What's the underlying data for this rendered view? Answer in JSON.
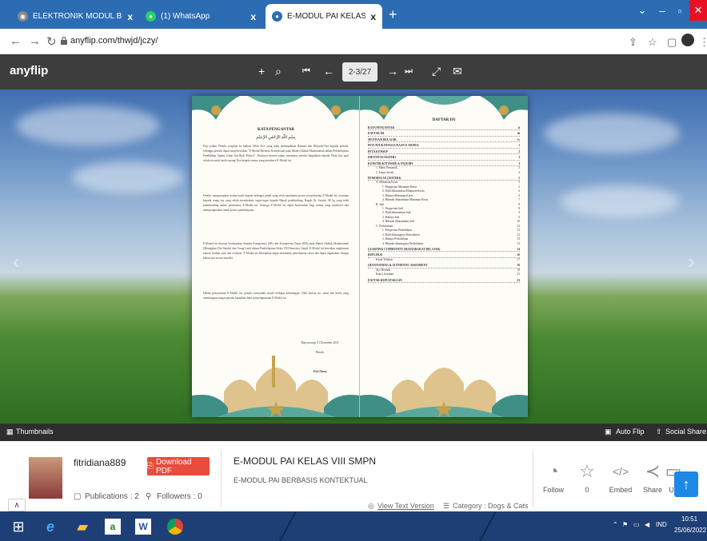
{
  "browser": {
    "tabs": [
      {
        "label": "ELEKTRONIK MODUL BERBASIS I",
        "icon": "world-icon",
        "active": false
      },
      {
        "label": "(1) WhatsApp",
        "icon": "whatsapp-icon",
        "active": false
      },
      {
        "label": "E-MODUL PAI KELAS VIII SMPN",
        "icon": "anyflip-icon",
        "active": true
      }
    ],
    "close_glyph": "x",
    "new_tab_glyph": "+",
    "url": "anyflip.com/thwjd/jczy/"
  },
  "toolbar": {
    "logo": "anyflip",
    "page_indicator": "2-3/27"
  },
  "book": {
    "left_page": {
      "heading": "KATA PENGANTAR",
      "arabic_line": "بِسْمِ اللّٰهِ الرَّحْمٰنِ الرَّحِيْمِ",
      "paragraphs": [
        "Puji syukur Penulis ucapkan ke hadirat Allah Swt. yang telah melimpahkan Rahmat dan Hidayah-Nya kepada penulis, sehingga penulis dapat menyelesaikan \"E-Modul Berbasis Kontekstual pada Materi Akhlak Madzmumah dalam Pembelajaran Pendidikan Agama Islam dan Budi Pekerti\". Shalawat beserta salam senantiasa penulis limpahkan kepada Allah Swt agar selalu tercurah kasih sayang-Nya kepada semua yang membaca E-Modul ini.",
        "Penulis mengucapkan terima kasih kepada berbagai pihak yang telah membantu proses penyelesaian E-Modul ini, terutama kepada orang tua yang selalu mendoakan, tugas-tugas kepada Bapak pembimbing, Bapak Dr. Isnaini, M.Ag yang telah membimbing dalam pembuatan E-Modul ini. Semoga E-Modul ini dapat bermanfaat bagi semua yang membaca dan mempergunakan untuk proses pembelajaran.",
        "E-Modul ini disusun berdasarkan Standar Kompetensi (SK) dan Kompetensi Dasar (KD) pada Materi Akhlak Madzmumah (Merugikan Diri Sendiri dan Orang Lain) dalam Pembelajaran Kelas VIII Semester Ganjil. E-Modul ini berisikan rangkuman materi, latihan soal, dan evaluasi. E-Modul ini diharapkan dapat membantu pemahaman siswa dan dapat digunakan sebagai bahan ajar secara mandiri.",
        "Dalam penyusunan E-Modul ini, penulis menyadari masih terdapat kekurangan. Oleh karena itu, saran dan kritik yang membangun sangat penulis harapkan demi penyempurnaan E-Modul ini."
      ],
      "place_date": "Banyuwangi, 01 Desember 2021",
      "signer_role": "Penulis",
      "signer_name": "Fitri Diana"
    },
    "right_page": {
      "heading": "DAFTAR ISI",
      "toc": [
        {
          "t": "KATA PENGANTAR",
          "p": "ii",
          "lvl": 0
        },
        {
          "t": "DAFTAR ISI",
          "p": "iii",
          "lvl": 0
        },
        {
          "t": "MOTIVASI BELAJAR",
          "p": "iv",
          "lvl": 0
        },
        {
          "t": "PETUNJUK PENGGUNAAN E-MODUL",
          "p": "1",
          "lvl": 0
        },
        {
          "t": "PETA KONSEP",
          "p": "2",
          "lvl": 0
        },
        {
          "t": "IDENTITAS MATERI",
          "p": "3",
          "lvl": 0
        },
        {
          "t": "KONSTRUKTIVISME & INQUIRY",
          "p": "3",
          "lvl": 0
        },
        {
          "t": "1. Menit Pemantik",
          "p": "3",
          "lvl": 1
        },
        {
          "t": "2. Tanya Jawab",
          "p": "4",
          "lvl": 1
        },
        {
          "t": "PEMODELAN (MATERI)",
          "p": "5",
          "lvl": 0
        },
        {
          "t": "A. Minuman Keras",
          "p": "5",
          "lvl": 1
        },
        {
          "t": "1. Pengertian Minuman Keras",
          "p": "5",
          "lvl": 2
        },
        {
          "t": "2. Dalil diharamkan Minuman Keras",
          "p": "6",
          "lvl": 2
        },
        {
          "t": "3. Bahaya Minuman Keras",
          "p": "6",
          "lvl": 2
        },
        {
          "t": "4. Hikmah diharamkan Minuman Keras",
          "p": "7",
          "lvl": 2
        },
        {
          "t": "B. Judi",
          "p": "8",
          "lvl": 1
        },
        {
          "t": "1. Pengertian Judi",
          "p": "8",
          "lvl": 2
        },
        {
          "t": "2. Dalil diharamkan Judi",
          "p": "9",
          "lvl": 2
        },
        {
          "t": "3. Bahaya Judi",
          "p": "9",
          "lvl": 2
        },
        {
          "t": "4. Hikmah diharamkan Judi",
          "p": "10",
          "lvl": 2
        },
        {
          "t": "C. Perkelahian",
          "p": "12",
          "lvl": 1
        },
        {
          "t": "1. Pengertian Perkelahian",
          "p": "12",
          "lvl": 2
        },
        {
          "t": "2. Dalil dilarangnya Perkelahian",
          "p": "12",
          "lvl": 2
        },
        {
          "t": "3. Bahaya Perkelahian",
          "p": "13",
          "lvl": 2
        },
        {
          "t": "4. Hikmah dilarangnya Perkelahian",
          "p": "13",
          "lvl": 2
        },
        {
          "t": "LEARNING COMMUNITY (MASYARAKAT BELAJAR)",
          "p": "14",
          "lvl": 0
        },
        {
          "t": "REFLEKSI",
          "p": "16",
          "lvl": 0
        },
        {
          "t": "Kisah Teladan",
          "p": "17",
          "lvl": 1
        },
        {
          "t": "QUESTIONING & AUTHENTIC ASSESMENT",
          "p": "18",
          "lvl": 0
        },
        {
          "t": "Ayo Berlatih",
          "p": "18",
          "lvl": 1
        },
        {
          "t": "Kunci Jawaban",
          "p": "21",
          "lvl": 1
        },
        {
          "t": "DAFTAR KEPUSTAKAAN",
          "p": "23",
          "lvl": 0
        }
      ]
    }
  },
  "bottom_bar": {
    "thumbnails": "Thumbnails",
    "auto_flip": "Auto Flip",
    "social_share": "Social Share"
  },
  "info": {
    "username": "fitridiana889",
    "download": "Download PDF",
    "publications": "Publications : 2",
    "followers": "Followers : 0",
    "book_title": "E-MODUL PAI KELAS VIII SMPN",
    "book_subtitle": "E-MODUL PAI BERBASIS KONTEKTUAL",
    "view_text": "View Text Version",
    "category": "Category : Dogs & Cats",
    "actions": {
      "follow": "Follow",
      "like_count": "0",
      "embed": "Embed",
      "share": "Share",
      "upload": "Up"
    }
  },
  "taskbar": {
    "lang": "IND",
    "time": "10:51",
    "date": "25/06/2022"
  },
  "colors": {
    "tab_strip": "#2b6cb3",
    "anyflip_bar": "#3d3d3d",
    "download_button": "#e74c3c",
    "taskbar": "#1e3f75"
  }
}
